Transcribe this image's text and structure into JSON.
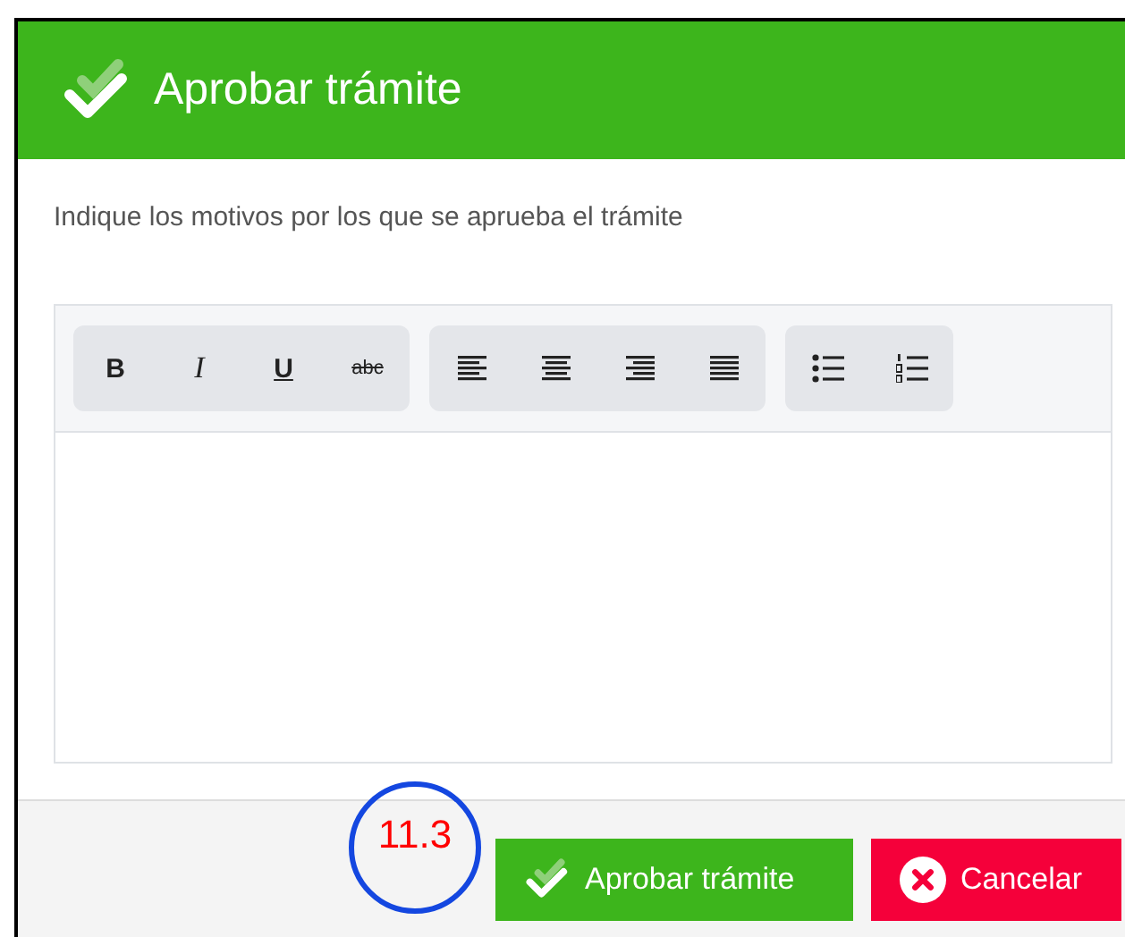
{
  "dialog": {
    "title": "Aprobar trámite",
    "instruction": "Indique los motivos por los que se aprueba el trámite",
    "toolbar": [
      {
        "buttons": [
          {
            "kind": "bold",
            "label": "B"
          },
          {
            "kind": "italic",
            "label": "I"
          },
          {
            "kind": "underline",
            "label": "U"
          },
          {
            "kind": "strike",
            "label": "abc"
          }
        ]
      },
      {
        "buttons": [
          {
            "kind": "align-left"
          },
          {
            "kind": "align-center"
          },
          {
            "kind": "align-right"
          },
          {
            "kind": "justify"
          }
        ]
      },
      {
        "buttons": [
          {
            "kind": "bullet-list"
          },
          {
            "kind": "numbered-list"
          }
        ]
      }
    ],
    "buttons": [
      {
        "kind": "approve",
        "label": "Aprobar trámite"
      },
      {
        "kind": "cancel",
        "label": "Cancelar"
      }
    ]
  },
  "annotation": {
    "label": "11.3"
  }
}
